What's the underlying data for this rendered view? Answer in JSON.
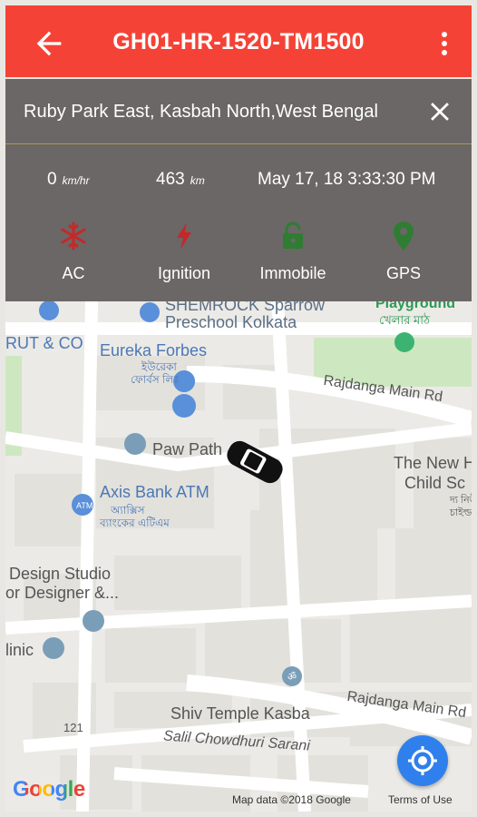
{
  "header": {
    "title": "GH01-HR-1520-TM1500",
    "back_icon": "arrow-back-icon",
    "menu_icon": "more-vert-icon",
    "color": "#f44336"
  },
  "info_panel": {
    "address": "Ruby Park East, Kasbah North,West Bengal",
    "close_icon": "close-icon",
    "speed": {
      "value": "0",
      "unit": "km/hr"
    },
    "distance": {
      "value": "463",
      "unit": "km"
    },
    "timestamp": "May 17, 18 3:33:30 PM",
    "features": [
      {
        "label": "AC",
        "icon": "snowflake-icon",
        "color": "#c62828"
      },
      {
        "label": "Ignition",
        "icon": "bolt-icon",
        "color": "#c62828"
      },
      {
        "label": "Immobile",
        "icon": "lock-icon",
        "color": "#2e7d32"
      },
      {
        "label": "GPS",
        "icon": "map-pin-icon",
        "color": "#2e7d32"
      }
    ]
  },
  "map": {
    "labels": {
      "shemrock": "SHEMROCK Sparrow",
      "preschool": "Preschool Kolkata",
      "playground": "Playground",
      "playground_bn": "খেলার মাঠ",
      "rut": "RUT & CO",
      "eureka": "Eureka Forbes",
      "eureka_bn": "ইউরেকা",
      "eureka_bn2": "ফোর্বস লিঃ",
      "rajdanga1": "Rajdanga Main Rd",
      "paw": "Paw Path",
      "newh": "The New H",
      "child": "Child Sc",
      "child_bn": "দ্য নিউ",
      "child_bn2": "চাইল্ড",
      "axis": "Axis Bank ATM",
      "axis_bn": "অ্যাক্সিস",
      "axis_bn2": "ব্যাংকের এটিএম",
      "design": "Design Studio",
      "designer": "or Designer &...",
      "clinic": "linic",
      "shiv": "Shiv Temple Kasba",
      "rajdanga2": "Rajdanga Main Rd",
      "n121": "121",
      "salil": "Salil Chowdhuri Sarani"
    },
    "google_logo": "Google",
    "map_data": "Map data ©2018 Google",
    "terms": "Terms of Use",
    "locate_icon": "my-location-icon",
    "vehicle_icon": "car-icon"
  }
}
